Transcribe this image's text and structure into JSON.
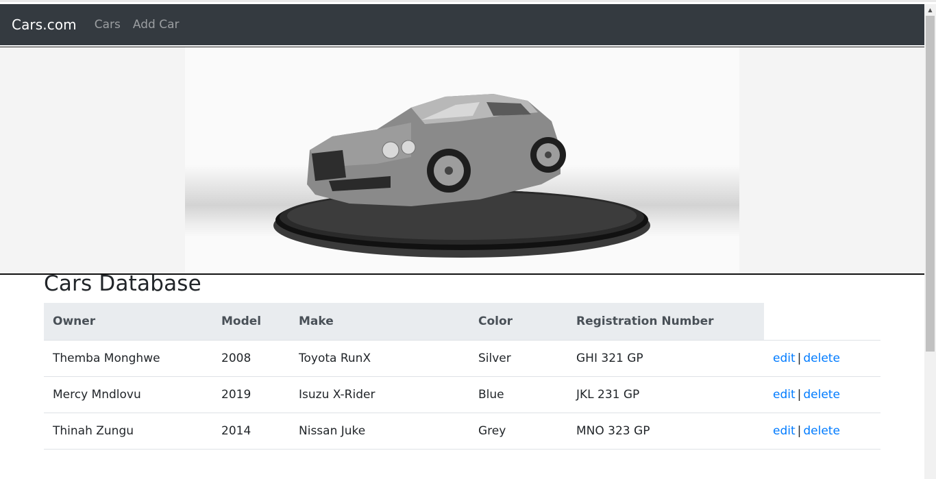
{
  "navbar": {
    "brand": "Cars.com",
    "links": [
      "Cars",
      "Add Car"
    ]
  },
  "hero": {
    "image_alt": "car-on-turntable"
  },
  "main": {
    "title": "Cars Database",
    "columns": [
      "Owner",
      "Model",
      "Make",
      "Color",
      "Registration Number"
    ],
    "rows": [
      {
        "owner": "Themba Monghwe",
        "model": "2008",
        "make": "Toyota RunX",
        "color": "Silver",
        "reg": "GHI 321 GP"
      },
      {
        "owner": "Mercy Mndlovu",
        "model": "2019",
        "make": "Isuzu X-Rider",
        "color": "Blue",
        "reg": "JKL 231 GP"
      },
      {
        "owner": "Thinah Zungu",
        "model": "2014",
        "make": "Nissan Juke",
        "color": "Grey",
        "reg": "MNO 323 GP"
      }
    ],
    "actions": {
      "edit": "edit",
      "separator": "|",
      "delete": "delete"
    }
  },
  "colors": {
    "navbar_bg": "#343a40",
    "link": "#007bff",
    "table_header_bg": "#e9ecef"
  },
  "icons": {
    "scroll_up": "triangle-up-icon"
  }
}
